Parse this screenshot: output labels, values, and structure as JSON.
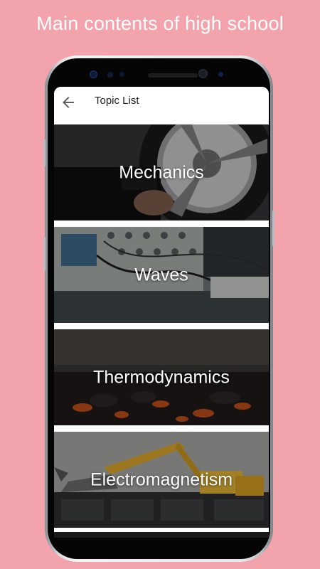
{
  "promo": {
    "headline": "Main contents of high school"
  },
  "appbar": {
    "title": "Topic List",
    "back_icon": "arrow-back-icon"
  },
  "topics": [
    {
      "label": "Mechanics"
    },
    {
      "label": "Waves"
    },
    {
      "label": "Thermodynamics"
    },
    {
      "label": "Electromagnetism"
    }
  ],
  "colors": {
    "background": "#f2a3ab",
    "headline_text": "#ffffff",
    "appbar_bg": "#ffffff",
    "appbar_text": "#212121",
    "card_label": "#ffffff"
  }
}
